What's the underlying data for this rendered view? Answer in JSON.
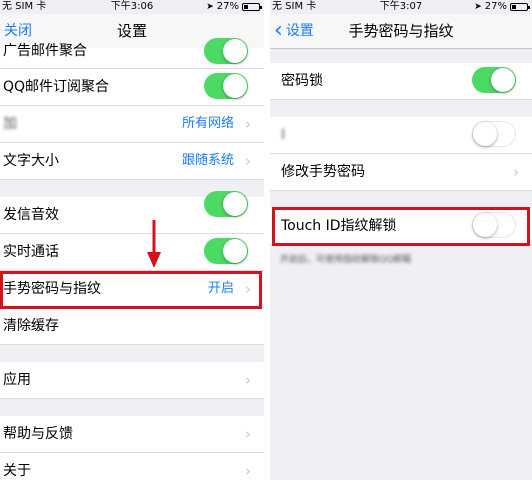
{
  "left": {
    "status": {
      "carrier": "无 SIM 卡",
      "time": "下午3:06",
      "battery": "27%",
      "battery_level": 0.27
    },
    "nav": {
      "back": "关闭",
      "title": "设置"
    },
    "rows": {
      "mail_aggregate": "广告邮件聚合",
      "qq_subscribe": "QQ邮件订阅聚合",
      "download": "加",
      "download_value": "所有网络",
      "font_size": "文字大小",
      "font_size_value": "跟随系统",
      "notify_sound": "发信音效",
      "realtime": "实时通话",
      "gesture": "手势密码与指纹",
      "gesture_value": "开启",
      "clear_cache": "清除缓存",
      "apps": "应用",
      "help": "帮助与反馈",
      "about": "关于"
    }
  },
  "right": {
    "status": {
      "carrier": "无 SIM 卡",
      "time": "下午3:07",
      "battery": "27%",
      "battery_level": 0.27
    },
    "nav": {
      "back": "设置",
      "title": "手势密码与指纹"
    },
    "rows": {
      "passcode": "密码锁",
      "show_track": "I",
      "change_gesture": "修改手势密码",
      "touch_id": "Touch ID指纹解锁"
    },
    "footer_note": "开启后，可使用指纹解锁QQ邮箱"
  },
  "colors": {
    "accent": "#1a7cf6",
    "switch_on": "#4cd964",
    "highlight": "#d4111d"
  }
}
